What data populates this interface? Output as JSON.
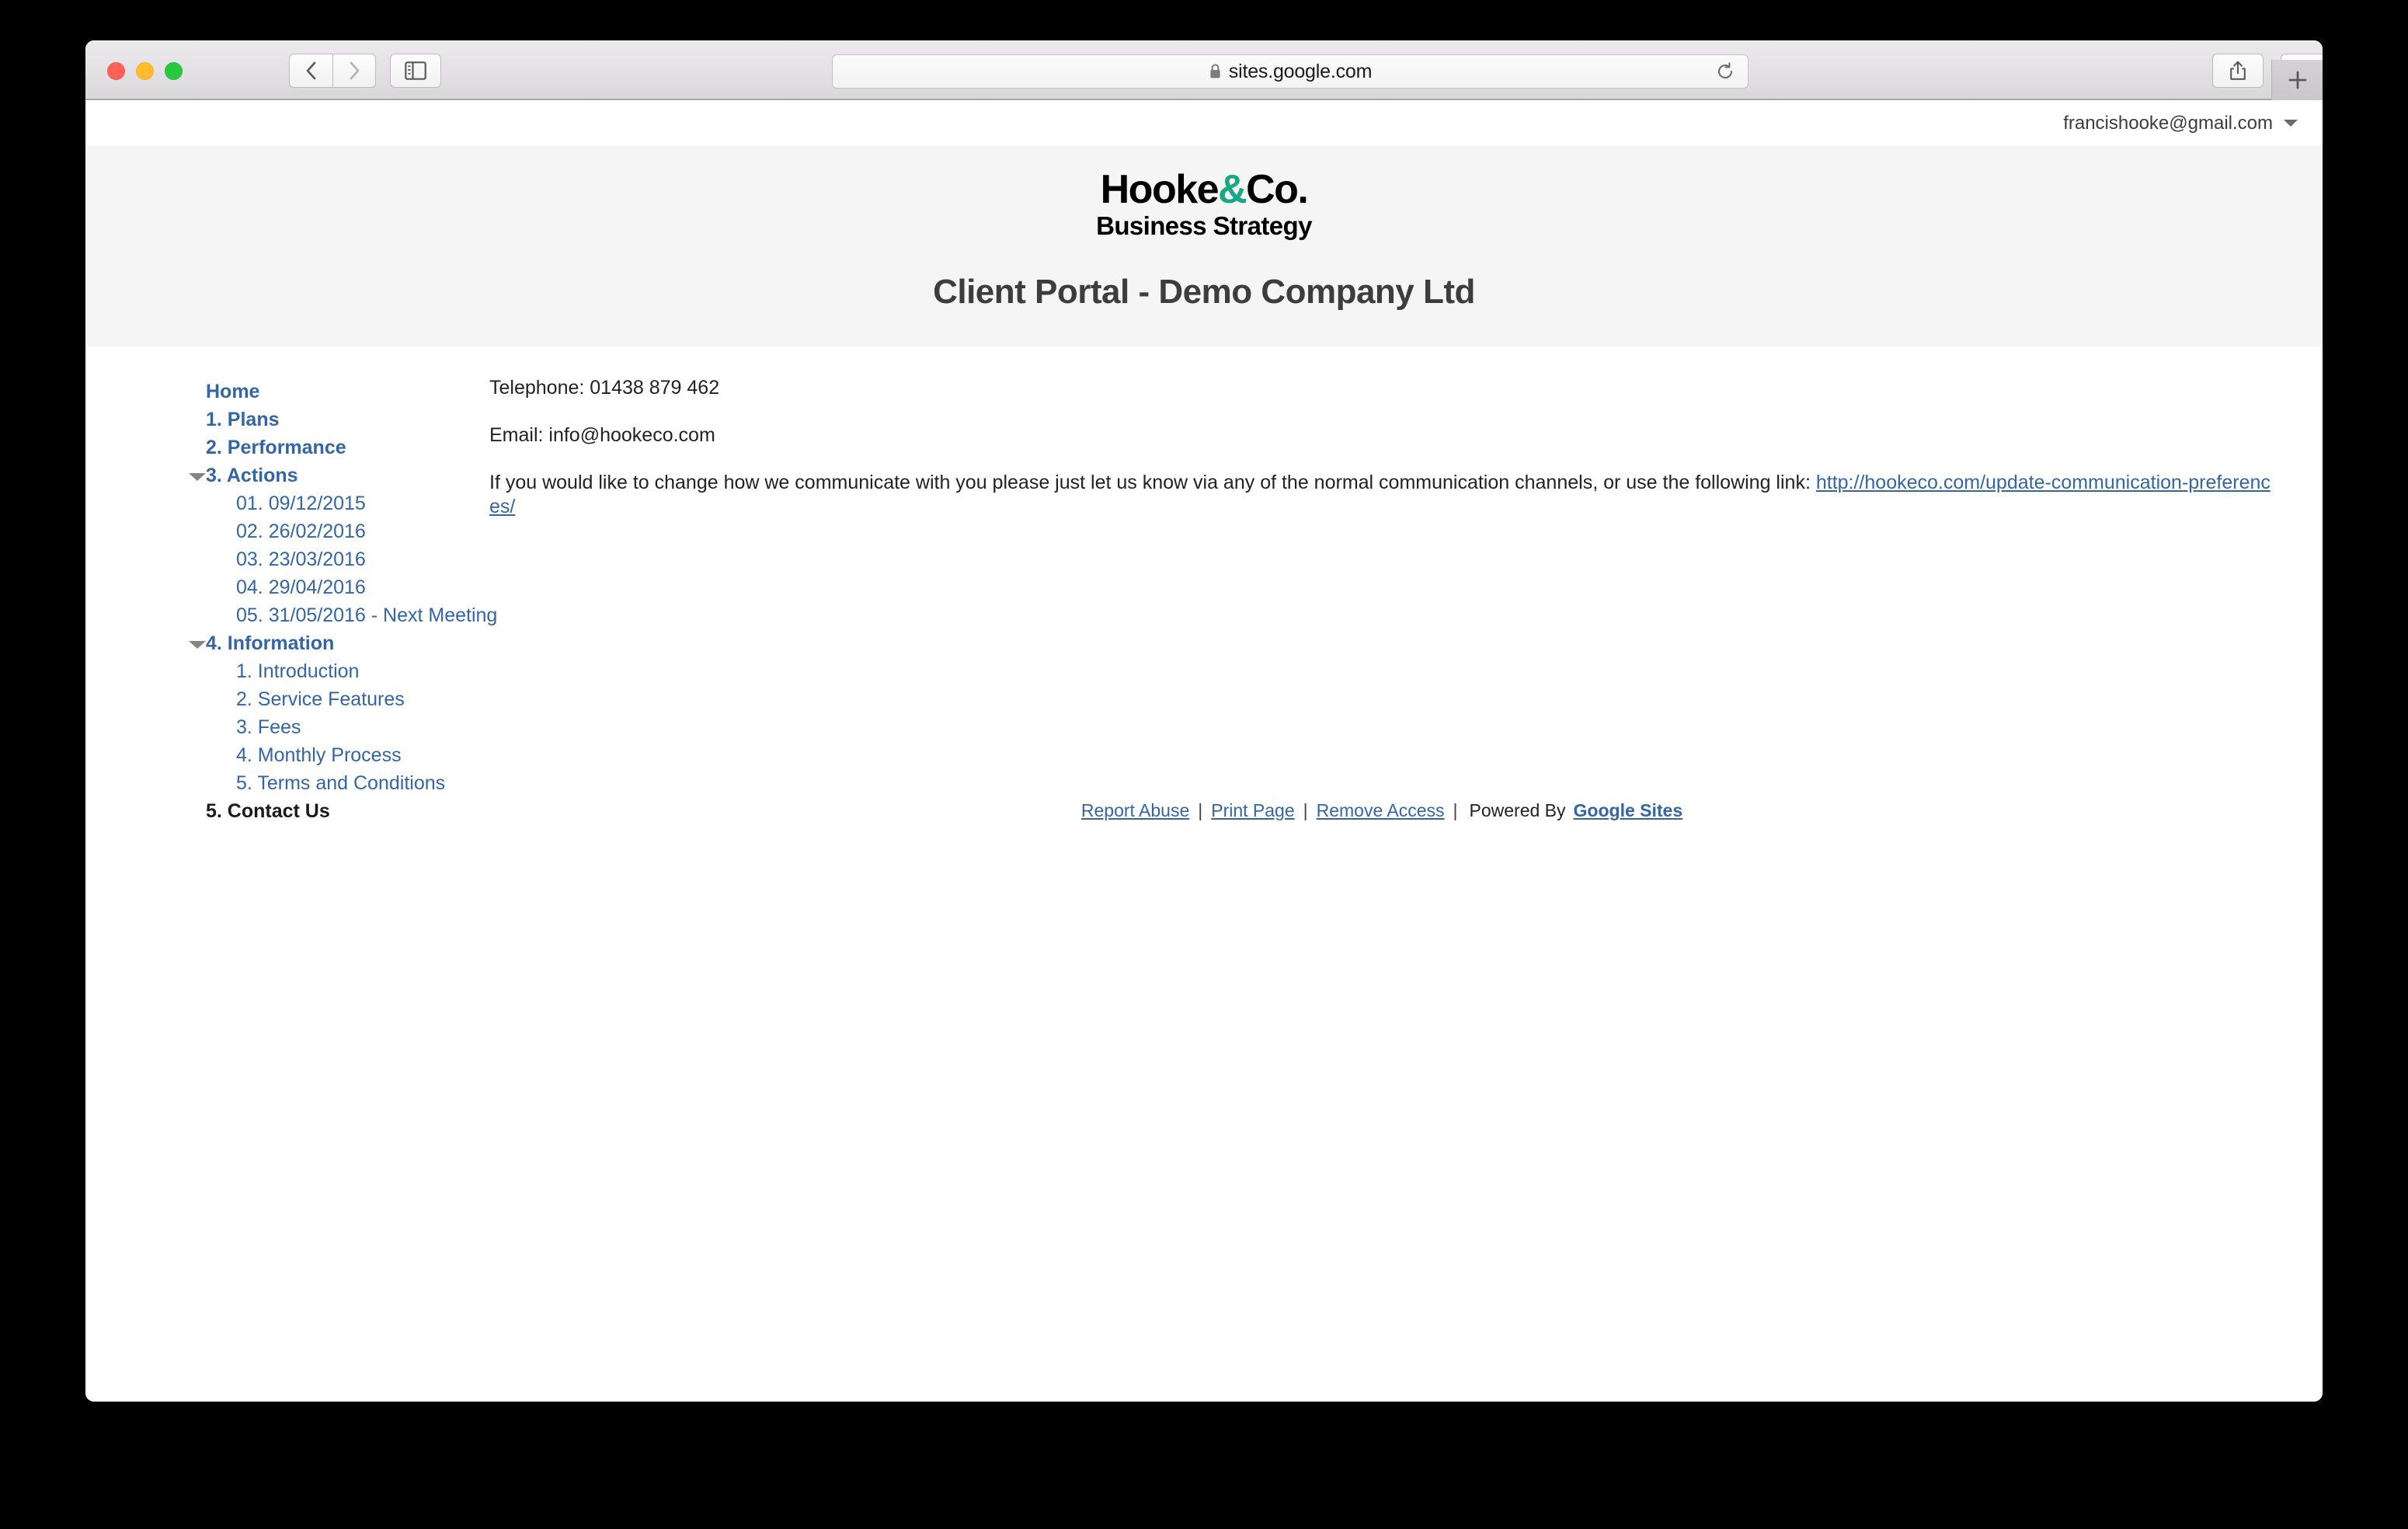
{
  "browser": {
    "url": "sites.google.com",
    "lock_icon": "lock-icon",
    "back_icon": "chevron-left-icon",
    "forward_icon": "chevron-right-icon",
    "sidebar_icon": "sidebar-toggle-icon",
    "reload_icon": "reload-icon",
    "share_icon": "share-icon",
    "tabs_icon": "tab-overview-icon",
    "newtab_icon": "plus-icon",
    "traffic_lights": [
      "close-button",
      "minimize-button",
      "zoom-button"
    ]
  },
  "account": {
    "email": "francishooke@gmail.com",
    "caret_icon": "chevron-down-icon"
  },
  "site": {
    "logo_line1_a": "Hooke",
    "logo_line1_amp": "&",
    "logo_line1_b": "Co.",
    "logo_line2": "Business Strategy",
    "title": "Client Portal - Demo Company Ltd",
    "accent_color": "#18a883",
    "link_color": "#3465a4",
    "header_bg": "#f5f5f5"
  },
  "sidebar": {
    "items": [
      {
        "label": "Home",
        "level": 0,
        "caret": false,
        "current": false
      },
      {
        "label": "1. Plans",
        "level": 0,
        "caret": false,
        "current": false
      },
      {
        "label": "2. Performance",
        "level": 0,
        "caret": false,
        "current": false
      },
      {
        "label": "3. Actions",
        "level": 0,
        "caret": true,
        "current": false
      },
      {
        "label": "01. 09/12/2015",
        "level": 1,
        "caret": false,
        "current": false
      },
      {
        "label": "02. 26/02/2016",
        "level": 1,
        "caret": false,
        "current": false
      },
      {
        "label": "03. 23/03/2016",
        "level": 1,
        "caret": false,
        "current": false
      },
      {
        "label": "04. 29/04/2016",
        "level": 1,
        "caret": false,
        "current": false
      },
      {
        "label": "05. 31/05/2016 - Next Meeting",
        "level": 1,
        "caret": false,
        "current": false
      },
      {
        "label": "4. Information",
        "level": 0,
        "caret": true,
        "current": false
      },
      {
        "label": "1. Introduction",
        "level": 1,
        "caret": false,
        "current": false
      },
      {
        "label": "2. Service Features",
        "level": 1,
        "caret": false,
        "current": false
      },
      {
        "label": "3. Fees",
        "level": 1,
        "caret": false,
        "current": false
      },
      {
        "label": "4. Monthly Process",
        "level": 1,
        "caret": false,
        "current": false
      },
      {
        "label": "5. Terms and Conditions",
        "level": 1,
        "caret": false,
        "current": false
      },
      {
        "label": "5. Contact Us",
        "level": 0,
        "caret": false,
        "current": true
      }
    ]
  },
  "content": {
    "telephone": "Telephone: 01438 879 462",
    "email": "Email: info@hookeco.com",
    "notice_prefix": "If you would like to change how we communicate with you please just let us know via any of the normal communication channels, or use the following link: ",
    "notice_link": "http://hookeco.com/update-communication-preferences/"
  },
  "footer": {
    "report_abuse": "Report Abuse",
    "print_page": "Print Page",
    "remove_access": "Remove Access",
    "separator": "|",
    "powered_by": "Powered By",
    "google_sites": "Google Sites"
  }
}
